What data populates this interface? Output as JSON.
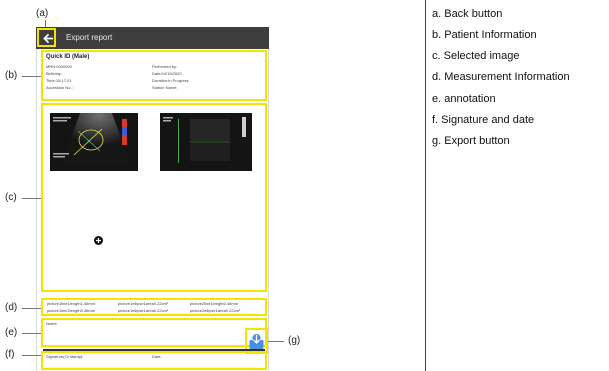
{
  "callouts": {
    "a": "(a)",
    "b": "(b)",
    "c": "(c)",
    "d": "(d)",
    "e": "(e)",
    "f": "(f)",
    "g": "(g)"
  },
  "screen": {
    "title": "Export report",
    "patient": {
      "name": "Quick ID",
      "sex": "(Male)",
      "mrn": "MRN:0000000",
      "birthday": "Birthday:",
      "time": "Time:15:17:21",
      "accession": "Accession No.:",
      "performed_by": "Performed by:",
      "date": "Date:04/15/2020",
      "duration": "Duration:In Progress",
      "station": "Station Name:"
    },
    "measurements": {
      "r1c1": "picture1line1length1.46mm",
      "r1c2": "picture1ellipse1area0.22cm²",
      "r1c3": "picture2line1length0.46mm",
      "r2c1": "picture1line2length0.46mm",
      "r2c2": "picture1ellipse1area0.22cm²",
      "r2c3": "picture2ellipse1area0.22cm²"
    },
    "notes_label": "Notes:",
    "signature_label": "Signature(Or stamp):",
    "date_label": "Date:"
  },
  "legend": [
    "a. Back button",
    "b. Patient Information",
    "c. Selected image",
    "d. Measurement Information",
    "e. annotation",
    "f. Signature and date",
    "g. Export button"
  ]
}
